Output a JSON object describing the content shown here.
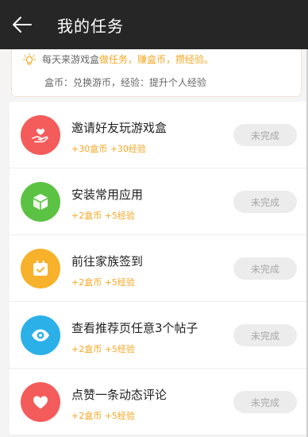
{
  "header": {
    "title": "我的任务"
  },
  "info": {
    "prefix": "每天来游戏盒 ",
    "do_tasks": "做任务，",
    "earn_coins": "赚盒币，",
    "earn_exp": "攒经验。",
    "line2": "盒币：兑换游币，经验：提升个人经验"
  },
  "tasks": [
    {
      "title": "邀请好友玩游戏盒",
      "reward": "+30盒币 +30经验",
      "button": "未完成",
      "icon": "heart-hand-icon",
      "color": "#f45b5b"
    },
    {
      "title": "安装常用应用",
      "reward": "+2盒币 +5经验",
      "button": "未完成",
      "icon": "cube-icon",
      "color": "#5cc243"
    },
    {
      "title": "前往家族签到",
      "reward": "+2盒币 +5经验",
      "button": "未完成",
      "icon": "calendar-check-icon",
      "color": "#f7b12a"
    },
    {
      "title": "查看推荐页任意3个帖子",
      "reward": "+2盒币 +5经验",
      "button": "未完成",
      "icon": "eye-icon",
      "color": "#2cb0e8"
    },
    {
      "title": "点赞一条动态评论",
      "reward": "+2盒币 +5经验",
      "button": "未完成",
      "icon": "heart-icon",
      "color": "#f45b5b"
    }
  ]
}
